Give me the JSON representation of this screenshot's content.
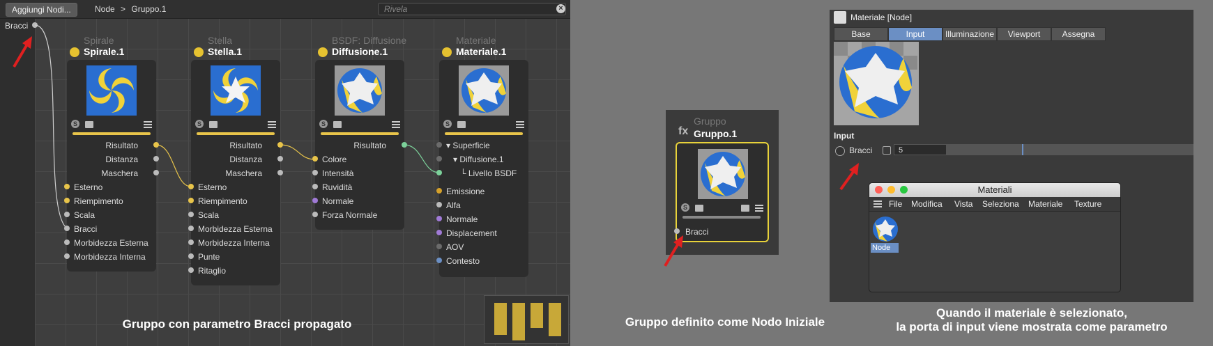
{
  "editor": {
    "add_button": "Aggiungi Nodi...",
    "breadcrumb": [
      "Node",
      ">",
      "Gruppo.1"
    ],
    "search_placeholder": "Rivela",
    "root_port": "Bracci",
    "caption": "Gruppo con parametro Bracci propagato"
  },
  "nodes": {
    "spirale": {
      "category": "Spirale",
      "name": "Spirale.1",
      "outputs": [
        "Risultato",
        "Distanza",
        "Maschera"
      ],
      "inputs": [
        "Esterno",
        "Riempimento",
        "Scala",
        "Bracci",
        "Morbidezza Esterna",
        "Morbidezza Interna"
      ]
    },
    "stella": {
      "category": "Stella",
      "name": "Stella.1",
      "outputs": [
        "Risultato",
        "Distanza",
        "Maschera"
      ],
      "inputs": [
        "Esterno",
        "Riempimento",
        "Scala",
        "Morbidezza Esterna",
        "Morbidezza Interna",
        "Punte",
        "Ritaglio"
      ]
    },
    "diffusione": {
      "category": "BSDF: Diffusione",
      "name": "Diffusione.1",
      "outputs": [
        "Risultato"
      ],
      "inputs": [
        "Colore",
        "Intensità",
        "Ruvidità",
        "Normale",
        "Forza Normale"
      ]
    },
    "materiale": {
      "category": "Materiale",
      "name": "Materiale.1",
      "inputs_top": [
        "Superficie",
        "Diffusione.1",
        "Livello BSDF"
      ],
      "inputs": [
        "Emissione",
        "Alfa",
        "Normale",
        "Displacement",
        "AOV",
        "Contesto"
      ]
    }
  },
  "group_node": {
    "category": "Gruppo",
    "fx": "fx",
    "name": "Gruppo.1",
    "port": "Bracci",
    "caption": "Gruppo definito come Nodo Iniziale"
  },
  "material_panel": {
    "title": "Materiale [Node]",
    "tabs": [
      "Base",
      "Input",
      "Illuminazione",
      "Viewport",
      "Assegna"
    ],
    "active_tab": "Input",
    "section": "Input",
    "param_label": "Bracci",
    "param_value": "5",
    "caption_line1": "Quando il materiale è selezionato,",
    "caption_line2": "la porta di input viene mostrata come parametro"
  },
  "materials_window": {
    "title": "Materiali",
    "menu": [
      "File",
      "Modifica",
      "Vista",
      "Seleziona",
      "Materiale",
      "Texture"
    ],
    "item_label": "Node"
  },
  "colors": {
    "accent_blue": "#6b8fc4",
    "wire_yellow": "#e8c44a",
    "wire_green": "#7cd19a",
    "group_border": "#e8d23a",
    "arrow_red": "#e02020"
  }
}
